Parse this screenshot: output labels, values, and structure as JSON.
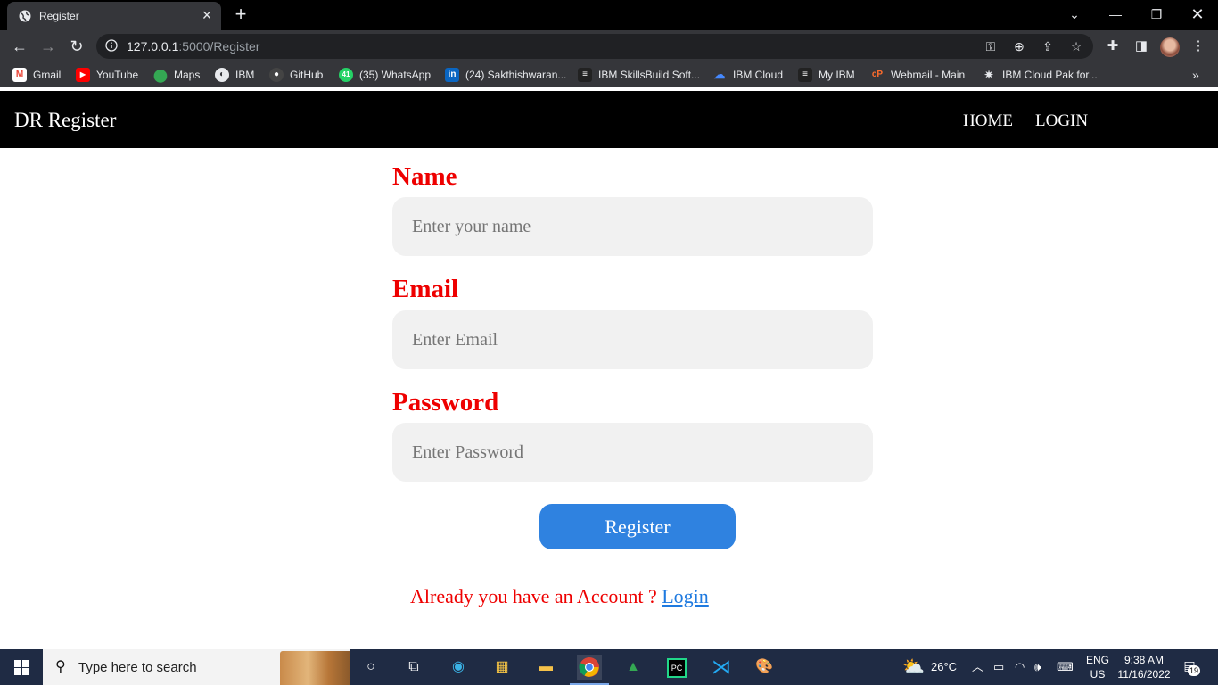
{
  "browser": {
    "tab_title": "Register",
    "url_host": "127.0.0.1",
    "url_rest": ":5000/Register",
    "bookmarks": [
      {
        "label": "Gmail",
        "icon": "gmail-icon",
        "color": "#ea4335"
      },
      {
        "label": "YouTube",
        "icon": "youtube-icon",
        "color": "#ff0000"
      },
      {
        "label": "Maps",
        "icon": "maps-icon",
        "color": "#34a853"
      },
      {
        "label": "IBM",
        "icon": "globe-icon",
        "color": "#e8eaed"
      },
      {
        "label": "GitHub",
        "icon": "github-icon",
        "color": "#444444"
      },
      {
        "label": "(35) WhatsApp",
        "icon": "whatsapp-icon",
        "color": "#25d366"
      },
      {
        "label": "(24) Sakthishwaran...",
        "icon": "linkedin-icon",
        "color": "#0a66c2"
      },
      {
        "label": "IBM SkillsBuild Soft...",
        "icon": "skillsbuild-icon",
        "color": "#222222"
      },
      {
        "label": "IBM Cloud",
        "icon": "ibm-cloud-icon",
        "color": "#4589ff"
      },
      {
        "label": "My IBM",
        "icon": "my-ibm-icon",
        "color": "#222222"
      },
      {
        "label": "Webmail - Main",
        "icon": "cpanel-icon",
        "color": "#ff6c2c"
      },
      {
        "label": "IBM Cloud Pak for...",
        "icon": "cloud-pak-icon",
        "color": "#222222"
      }
    ]
  },
  "navbar": {
    "brand": "DR Register",
    "links": [
      "HOME",
      "LOGIN"
    ]
  },
  "form": {
    "name_label": "Name",
    "name_placeholder": "Enter your name",
    "email_label": "Email",
    "email_placeholder": "Enter Email",
    "password_label": "Password",
    "password_placeholder": "Enter Password",
    "submit_label": "Register",
    "account_text": "Already you have an Account ?",
    "login_link": "Login"
  },
  "taskbar": {
    "search_placeholder": "Type here to search",
    "temperature": "26°C",
    "lang_top": "ENG",
    "lang_bottom": "US",
    "time": "9:38 AM",
    "date": "11/16/2022",
    "notification_count": "19"
  },
  "colors": {
    "label_red": "#ee0000",
    "button_blue": "#2f82e0",
    "link_blue": "#1e7ae0",
    "navbar_bg": "#000000"
  }
}
